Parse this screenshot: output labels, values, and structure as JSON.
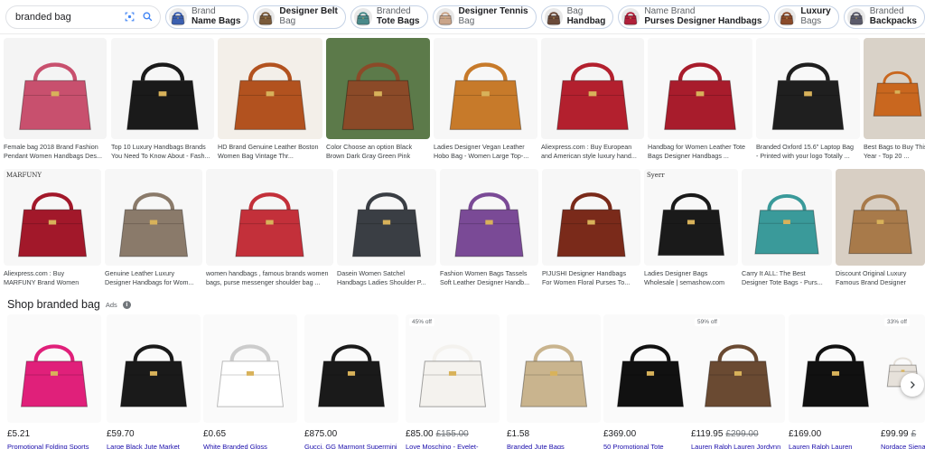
{
  "search": {
    "query": "branded bag"
  },
  "chips": [
    {
      "line1": "Brand",
      "line2": "Name Bags",
      "bold": 2,
      "color": "#3b5fb0"
    },
    {
      "line1": "Designer Belt",
      "line2": "Bag",
      "bold": 1,
      "color": "#7a5a3a"
    },
    {
      "line1": "Branded",
      "line2": "Tote Bags",
      "bold": 2,
      "color": "#4a8a8a"
    },
    {
      "line1": "Designer Tennis",
      "line2": "Bag",
      "bold": 1,
      "color": "#caa58a"
    },
    {
      "line1": "Bag",
      "line2": "Handbag",
      "bold": 2,
      "color": "#6a4a3a"
    },
    {
      "line1": "Name Brand",
      "line2": "Purses Designer Handbags",
      "bold": 2,
      "color": "#b0203a"
    },
    {
      "line1": "Luxury",
      "line2": "Bags",
      "bold": 1,
      "color": "#8a4a2a"
    },
    {
      "line1": "Branded",
      "line2": "Backpacks",
      "bold": 2,
      "color": "#5a5a6a"
    }
  ],
  "row1": [
    {
      "caption": "Female bag 2018 Brand Fashion Pendant Women Handbags Des...",
      "color": "#c8506e",
      "bg": "#f4f4f4"
    },
    {
      "caption": "Top 10 Luxury Handbags Brands You Need To Know About - Fash...",
      "color": "#1a1a1a",
      "bg": "#f6f6f6"
    },
    {
      "caption": "HD Brand Genuine Leather Boston Women Bag Vintage Thr...",
      "color": "#b2521f",
      "bg": "#f3efe9"
    },
    {
      "caption": "Color Choose an option Black Brown Dark Gray Green Pink Wine",
      "color": "#8b4a28",
      "bg": "#5c7a4a"
    },
    {
      "caption": "Ladies Designer Vegan Leather Hobo Bag - Women Large Top-...",
      "color": "#c77a2a",
      "bg": "#f7f7f7"
    },
    {
      "caption": "Aliexpress.com : Buy European and American style luxury hand...",
      "color": "#b3202e",
      "bg": "#f5f5f5"
    },
    {
      "caption": "Handbag for Women Leather Tote Bags Designer Handbags ...",
      "color": "#a81c2c",
      "bg": "#f8f8f8"
    },
    {
      "caption": "Branded Oxford 15.6\" Laptop Bag - Printed with your logo Totally ...",
      "color": "#1f1f1f",
      "bg": "#f8f8f8"
    },
    {
      "caption": "Best Bags to Buy This Year - Top 20 ...",
      "color": "#c9671f",
      "bg": "#d9d2c8"
    }
  ],
  "row2": [
    {
      "caption": "Aliexpress.com : Buy MARFUNY Brand Women Han...",
      "color": "#a2182a",
      "bg": "#f7f7f7",
      "mark": "MARFUNY"
    },
    {
      "caption": "Genuine Leather Luxury Designer Handbags for Wom...",
      "color": "#8a7a6a",
      "bg": "#f7f7f7"
    },
    {
      "caption": "women handbags , famous brands women bags, purse messenger shoulder bag ...",
      "color": "#c3303a",
      "bg": "#f6f6f6"
    },
    {
      "caption": "Dasein Women Satchel Handbags Ladies Shoulder P...",
      "color": "#3a3e44",
      "bg": "#f7f7f7"
    },
    {
      "caption": "Fashion Women Bags Tassels Soft Leather Designer Handb...",
      "color": "#7a4a96",
      "bg": "#f7f7f7"
    },
    {
      "caption": "PIJUSHI Designer Handbags For Women Floral Purses To...",
      "color": "#7a2a1a",
      "bg": "#f7f7f7"
    },
    {
      "caption": "Ladies Designer Bags Wholesale | semashow.com",
      "color": "#1a1a1a",
      "bg": "#f8f8f8",
      "mark": "Syerr"
    },
    {
      "caption": "Carry It ALL: The Best Designer Tote Bags - Purs...",
      "color": "#3a9a9a",
      "bg": "#f7f7f7"
    },
    {
      "caption": "Discount Original Luxury Famous Brand Designer Han...",
      "color": "#a87a4a",
      "bg": "#d8cfc4"
    }
  ],
  "shop": {
    "title": "Shop branded bag",
    "ads_label": "Ads",
    "products": [
      {
        "price": "£5.21",
        "old": "",
        "name": "Promotional Folding Sports",
        "discount": "",
        "color": "#e0207a"
      },
      {
        "price": "£59.70",
        "old": "",
        "name": "Large Black Jute Market",
        "discount": "",
        "color": "#1a1a1a"
      },
      {
        "price": "£0.65",
        "old": "",
        "name": "White Branded Gloss",
        "discount": "",
        "color": "#ffffff"
      },
      {
        "price": "£875.00",
        "old": "",
        "name": "Gucci, GG Marmont Supermini",
        "discount": "",
        "color": "#1a1a1a"
      },
      {
        "price": "£85.00",
        "old": "£155.00",
        "name": "Love Moschino - Eyelet-",
        "discount": "45% off",
        "color": "#f4f2ee"
      },
      {
        "price": "£1.58",
        "old": "",
        "name": "Branded Jute Bags",
        "discount": "",
        "color": "#c9b48e"
      },
      {
        "price": "£369.00",
        "old": "",
        "name": "50 Promotional Tote",
        "discount": "",
        "color": "#111111"
      },
      {
        "price": "£119.95",
        "old": "£299.00",
        "name": "Lauren Ralph Lauren Jordynn",
        "discount": "59% off",
        "color": "#6a4a32"
      },
      {
        "price": "£169.00",
        "old": "",
        "name": "Lauren Ralph Lauren",
        "discount": "",
        "color": "#111111"
      },
      {
        "price": "£99.99",
        "old": "£",
        "name": "Nordace Siena",
        "discount": "33% off",
        "color": "#e6e1da"
      }
    ]
  },
  "icons": {
    "lens": "lens-icon",
    "search": "search-icon",
    "next": "chevron-right-icon",
    "info": "info-icon"
  }
}
